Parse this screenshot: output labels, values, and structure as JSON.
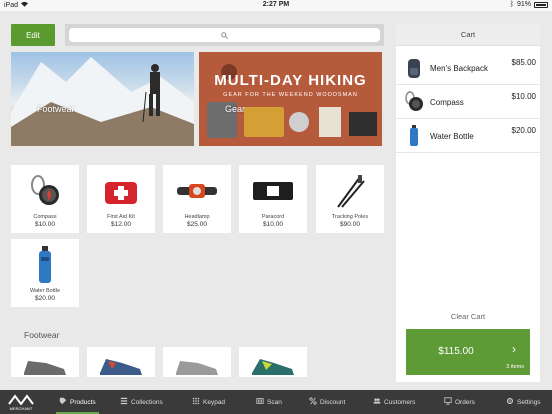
{
  "status": {
    "device": "iPad",
    "time": "2:27 PM",
    "battery": "91%"
  },
  "toolbar": {
    "edit_label": "Edit"
  },
  "banners": [
    {
      "label": "Footwear"
    },
    {
      "label": "Gear",
      "title": "MULTI-DAY HIKING",
      "subtitle": "GEAR FOR THE WEEKEND WOODSMAN"
    }
  ],
  "products": [
    {
      "name": "Compass",
      "price": "$10.00",
      "icon": "compass-icon"
    },
    {
      "name": "First Aid Kit",
      "price": "$12.00",
      "icon": "first-aid-kit-icon"
    },
    {
      "name": "Headlamp",
      "price": "$25.00",
      "icon": "headlamp-icon"
    },
    {
      "name": "Paracord",
      "price": "$10.00",
      "icon": "paracord-icon"
    },
    {
      "name": "Tracking Poles",
      "price": "$90.00",
      "icon": "trekking-poles-icon"
    },
    {
      "name": "Water Bottle",
      "price": "$20.00",
      "icon": "water-bottle-icon"
    }
  ],
  "footwear_section": {
    "title": "Footwear"
  },
  "cart": {
    "title": "Cart",
    "items": [
      {
        "name": "Men's Backpack",
        "price": "$85.00",
        "icon": "backpack-icon"
      },
      {
        "name": "Compass",
        "price": "$10.00",
        "icon": "compass-icon"
      },
      {
        "name": "Water Bottle",
        "price": "$20.00",
        "icon": "water-bottle-icon"
      }
    ],
    "clear_label": "Clear Cart",
    "total": "$115.00",
    "count": "3 items",
    "accent": "#5e9b36"
  },
  "tabs": [
    {
      "label": "Products",
      "icon": "tag-icon",
      "active": true
    },
    {
      "label": "Collections",
      "icon": "list-icon"
    },
    {
      "label": "Keypad",
      "icon": "keypad-icon"
    },
    {
      "label": "Scan",
      "icon": "scan-icon"
    },
    {
      "label": "Discount",
      "icon": "percent-icon"
    },
    {
      "label": "Customers",
      "icon": "customers-icon"
    },
    {
      "label": "Orders",
      "icon": "orders-icon"
    },
    {
      "label": "Settings",
      "icon": "gear-icon"
    }
  ],
  "logo": {
    "text": "MERCHANT"
  }
}
